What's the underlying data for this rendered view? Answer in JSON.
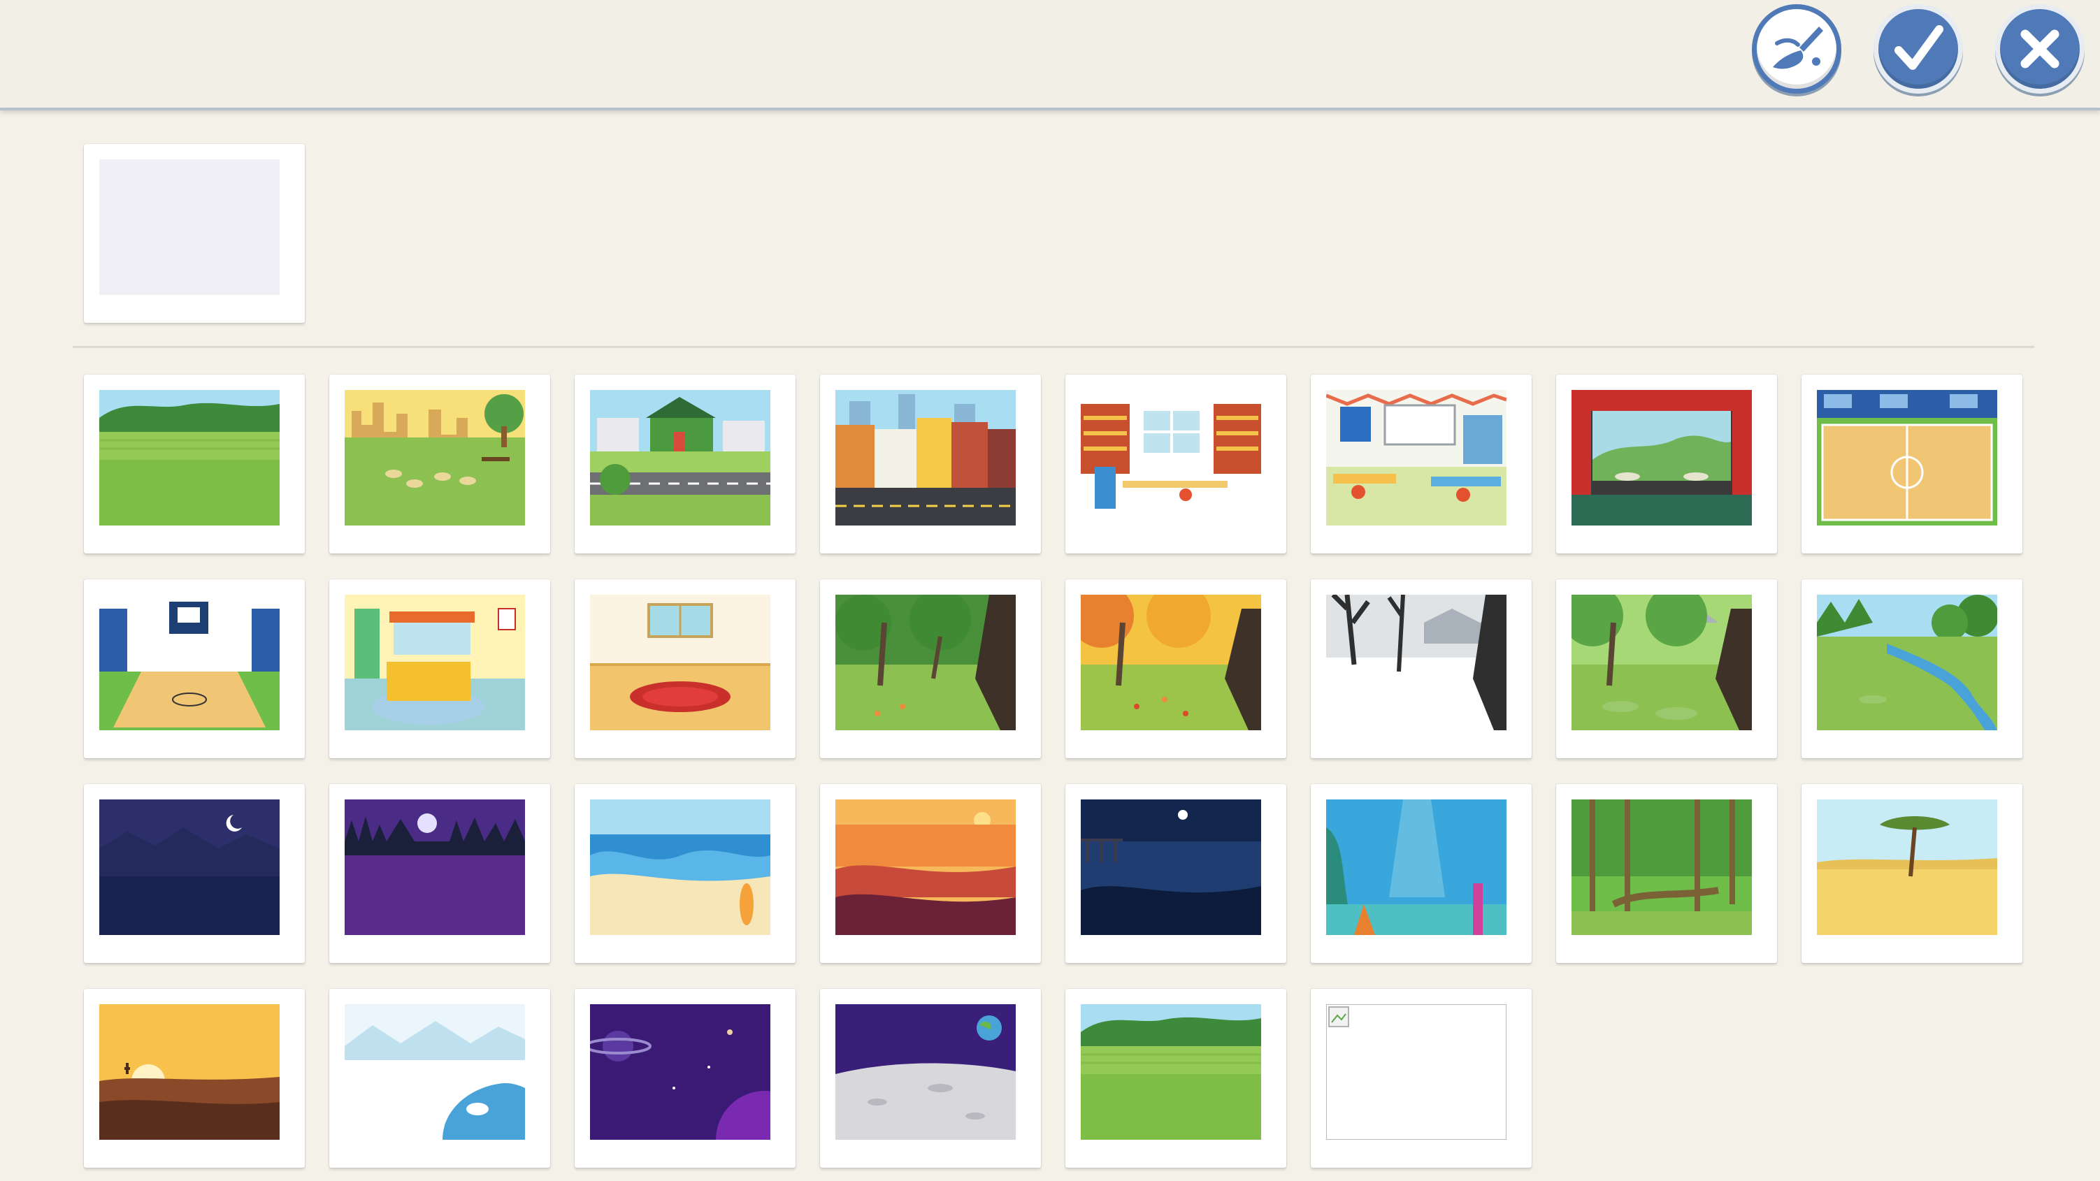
{
  "toolbar": {
    "buttons": [
      {
        "name": "paint-button",
        "icon": "paintbrush-icon"
      },
      {
        "name": "confirm-button",
        "icon": "checkmark-icon"
      },
      {
        "name": "close-button",
        "icon": "close-icon"
      }
    ]
  },
  "selected_background": {
    "state": "empty"
  },
  "backgrounds": [
    {
      "name": "farm-field",
      "scene": "farm"
    },
    {
      "name": "city-park",
      "scene": "park"
    },
    {
      "name": "suburb-street",
      "scene": "suburb"
    },
    {
      "name": "city-street",
      "scene": "citystreet"
    },
    {
      "name": "library",
      "scene": "library"
    },
    {
      "name": "classroom",
      "scene": "classroom"
    },
    {
      "name": "theater-stage",
      "scene": "theater"
    },
    {
      "name": "basketball-court-top",
      "scene": "courttop"
    },
    {
      "name": "gym",
      "scene": "gym"
    },
    {
      "name": "bedroom",
      "scene": "bedroom"
    },
    {
      "name": "empty-room",
      "scene": "room"
    },
    {
      "name": "orchard-summer",
      "scene": "orchard"
    },
    {
      "name": "orchard-autumn",
      "scene": "autumn"
    },
    {
      "name": "orchard-winter",
      "scene": "winter"
    },
    {
      "name": "orchard-spring",
      "scene": "spring"
    },
    {
      "name": "forest-stream",
      "scene": "stream"
    },
    {
      "name": "night-mountains",
      "scene": "nightmtn"
    },
    {
      "name": "night-forest",
      "scene": "nightforest"
    },
    {
      "name": "beach",
      "scene": "beach"
    },
    {
      "name": "sunset-sea",
      "scene": "sunset"
    },
    {
      "name": "night-pier",
      "scene": "pier"
    },
    {
      "name": "underwater",
      "scene": "underwater"
    },
    {
      "name": "jungle",
      "scene": "jungle"
    },
    {
      "name": "savanna",
      "scene": "savanna"
    },
    {
      "name": "desert",
      "scene": "desert"
    },
    {
      "name": "arctic",
      "scene": "arctic"
    },
    {
      "name": "space-planet",
      "scene": "space"
    },
    {
      "name": "moon-surface",
      "scene": "moon"
    },
    {
      "name": "farm-field-2",
      "scene": "farm"
    },
    {
      "name": "broken-image",
      "scene": "broken"
    }
  ],
  "colors": {
    "accent": "#4f7ab7",
    "background": "#f3f1e8"
  }
}
